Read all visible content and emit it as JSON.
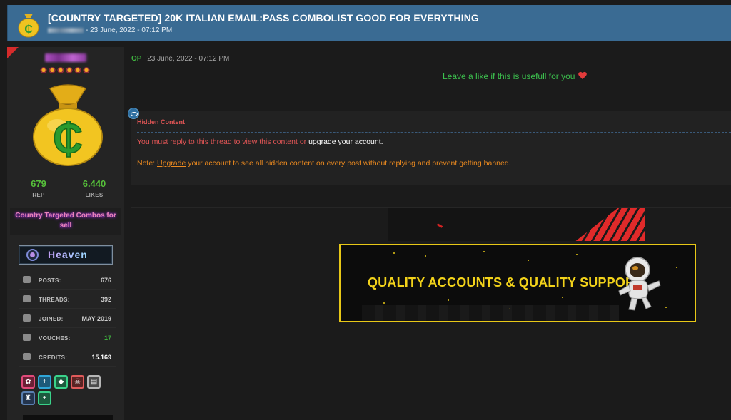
{
  "thread": {
    "title": "[COUNTRY TARGETED] 20K ITALIAN EMAIL:PASS COMBOLIST GOOD FOR EVERYTHING",
    "meta_date": "- 23 June, 2022 - 07:12 PM"
  },
  "user": {
    "rep": "679",
    "rep_label": "REP",
    "likes": "6.440",
    "likes_label": "LIKES",
    "usertitle": "Country Targeted Combos for sell",
    "badge": "Heaven",
    "stats": [
      {
        "icon": "posts-icon",
        "label": "POSTS:",
        "value": "676"
      },
      {
        "icon": "threads-icon",
        "label": "THREADS:",
        "value": "392"
      },
      {
        "icon": "calendar-icon",
        "label": "JOINED:",
        "value": "MAY 2019"
      },
      {
        "icon": "thumbs-up-icon",
        "label": "VOUCHES:",
        "value": "17"
      },
      {
        "icon": "credits-icon",
        "label": "CREDITS:",
        "value": "15.169"
      }
    ]
  },
  "post": {
    "op_tag": "OP",
    "date": "23 June, 2022 - 07:12 PM",
    "like_message": "Leave a like if this is usefull for you",
    "hidden": {
      "title": "Hidden Content",
      "message_prefix": "You must reply to this thread to view this content or ",
      "message_link": "upgrade your account.",
      "note_prefix": "Note: ",
      "note_link": "Upgrade",
      "note_suffix": " your account to see all hidden content on every post without replying and prevent getting banned."
    }
  },
  "signature": {
    "banner_text": "QUALITY ACCOUNTS & QUALITY SUPPORT"
  },
  "colors": {
    "header_bg": "#3a6b93",
    "rep_green": "#56c03a",
    "hidden_red": "#e05555",
    "note_orange": "#ec8a1f",
    "banner_gold": "#f2d21a"
  }
}
